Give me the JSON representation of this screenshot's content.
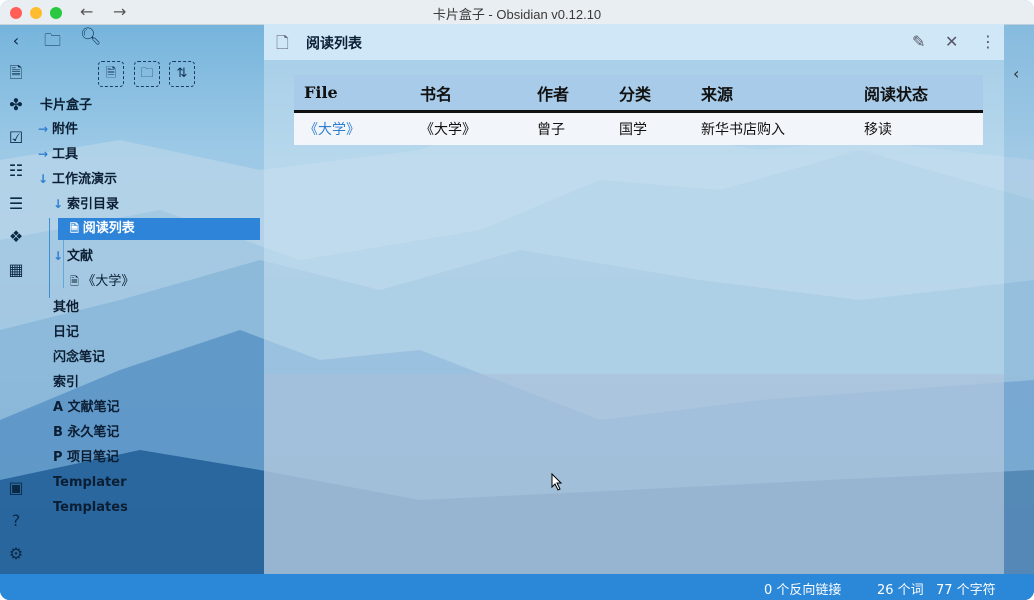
{
  "window": {
    "title": "卡片盒子 - Obsidian v0.12.10",
    "traffic_colors": [
      "#ff5f57",
      "#febc2e",
      "#28c840"
    ]
  },
  "ribbon": {
    "icons": [
      "collapse-left-icon",
      "file-list-icon",
      "graph-icon",
      "calendar-icon",
      "clipboard-icon",
      "stack-icon",
      "blocks-icon",
      "table-settings-icon",
      "vault-icon",
      "help-icon",
      "settings-icon"
    ]
  },
  "explorer": {
    "vault_name": "卡片盒子",
    "tree": [
      {
        "label": "附件",
        "arrow": "→"
      },
      {
        "label": "工具",
        "arrow": "→"
      },
      {
        "label": "工作流演示",
        "arrow": "↓"
      },
      {
        "label": "索引目录",
        "arrow": "↓"
      },
      {
        "label": "阅读列表",
        "arrow": ""
      },
      {
        "label": "文献",
        "arrow": "↓"
      },
      {
        "label": "《大学》",
        "arrow": ""
      },
      {
        "label": "其他",
        "arrow": ""
      },
      {
        "label": "日记",
        "arrow": ""
      },
      {
        "label": "闪念笔记",
        "arrow": ""
      },
      {
        "label": "索引",
        "arrow": ""
      },
      {
        "label": "A 文献笔记",
        "arrow": ""
      },
      {
        "label": "B 永久笔记",
        "arrow": ""
      },
      {
        "label": "P 项目笔记",
        "arrow": ""
      },
      {
        "label": "Templater",
        "arrow": ""
      },
      {
        "label": "Templates",
        "arrow": ""
      }
    ]
  },
  "tab": {
    "title": "阅读列表"
  },
  "table": {
    "headers": [
      "File",
      "书名",
      "作者",
      "分类",
      "来源",
      "阅读状态"
    ],
    "rows": [
      [
        "《大学》",
        "《大学》",
        "曾子",
        "国学",
        "新华书店购入",
        "移读"
      ]
    ]
  },
  "status": {
    "backlinks": "0 个反向链接",
    "words": "26 个词",
    "chars": "77 个字符"
  },
  "colors": {
    "accent": "#2b87d8",
    "link": "#2f7fd0"
  }
}
